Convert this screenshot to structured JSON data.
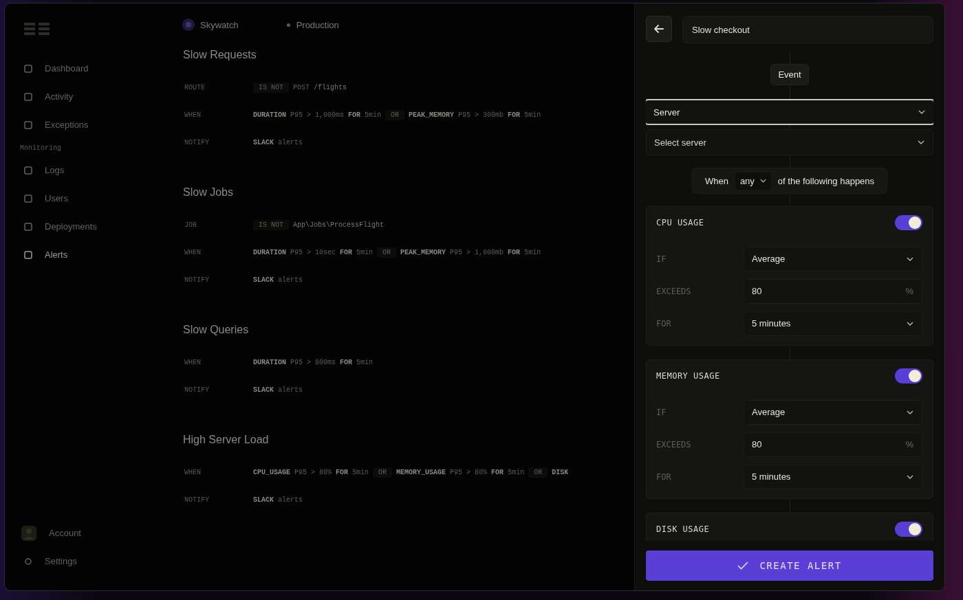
{
  "sidebar": {
    "groups": [
      {
        "items": [
          {
            "label": "Dashboard",
            "selected": false
          },
          {
            "label": "Activity",
            "selected": false
          },
          {
            "label": "Exceptions",
            "selected": false
          }
        ]
      },
      {
        "heading": "Monitoring",
        "items": [
          {
            "label": "Logs",
            "selected": false
          },
          {
            "label": "Users",
            "selected": false
          },
          {
            "label": "Deployments",
            "selected": false
          },
          {
            "label": "Alerts",
            "selected": true
          }
        ]
      }
    ],
    "footer": [
      {
        "label": "Account"
      },
      {
        "label": "Settings"
      }
    ]
  },
  "topbar": {
    "project": "Skywatch",
    "environment": "Production"
  },
  "rules": [
    {
      "title": "Slow Requests",
      "rows": [
        {
          "label": "ROUTE",
          "tokens": [
            {
              "kind": "op",
              "text": "IS NOT"
            },
            {
              "kind": "val",
              "text": "POST"
            },
            {
              "kind": "path",
              "text": "/flights"
            }
          ]
        },
        {
          "label": "WHEN",
          "tokens": [
            {
              "kind": "key",
              "text": "DURATION"
            },
            {
              "kind": "val",
              "text": "P95 > 1,000ms"
            },
            {
              "kind": "key",
              "text": "FOR"
            },
            {
              "kind": "val",
              "text": "5min"
            },
            {
              "kind": "op",
              "text": "OR"
            },
            {
              "kind": "key",
              "text": "PEAK_MEMORY"
            },
            {
              "kind": "val",
              "text": "P95 > 300mb"
            },
            {
              "kind": "key",
              "text": "FOR"
            },
            {
              "kind": "val",
              "text": "5min"
            }
          ]
        },
        {
          "label": "NOTIFY",
          "tokens": [
            {
              "kind": "key",
              "text": "SLACK"
            },
            {
              "kind": "val",
              "text": "alerts"
            }
          ]
        }
      ]
    },
    {
      "title": "Slow Jobs",
      "rows": [
        {
          "label": "JOB",
          "tokens": [
            {
              "kind": "op",
              "text": "IS NOT"
            },
            {
              "kind": "path",
              "text": "App\\Jobs\\ProcessFlight"
            }
          ]
        },
        {
          "label": "WHEN",
          "tokens": [
            {
              "kind": "key",
              "text": "DURATION"
            },
            {
              "kind": "val",
              "text": "P95 > 10sec"
            },
            {
              "kind": "key",
              "text": "FOR"
            },
            {
              "kind": "val",
              "text": "5min"
            },
            {
              "kind": "op",
              "text": "OR"
            },
            {
              "kind": "key",
              "text": "PEAK_MEMORY"
            },
            {
              "kind": "val",
              "text": "P95 > 1,000mb"
            },
            {
              "kind": "key",
              "text": "FOR"
            },
            {
              "kind": "val",
              "text": "5min"
            }
          ]
        },
        {
          "label": "NOTIFY",
          "tokens": [
            {
              "kind": "key",
              "text": "SLACK"
            },
            {
              "kind": "val",
              "text": "alerts"
            }
          ]
        }
      ]
    },
    {
      "title": "Slow Queries",
      "rows": [
        {
          "label": "WHEN",
          "tokens": [
            {
              "kind": "key",
              "text": "DURATION"
            },
            {
              "kind": "val",
              "text": "P95 > 800ms"
            },
            {
              "kind": "key",
              "text": "FOR"
            },
            {
              "kind": "val",
              "text": "5min"
            }
          ]
        },
        {
          "label": "NOTIFY",
          "tokens": [
            {
              "kind": "key",
              "text": "SLACK"
            },
            {
              "kind": "val",
              "text": "alerts"
            }
          ]
        }
      ]
    },
    {
      "title": "High Server Load",
      "rows": [
        {
          "label": "WHEN",
          "tokens": [
            {
              "kind": "key",
              "text": "CPU_USAGE"
            },
            {
              "kind": "val",
              "text": "P95 > 80%"
            },
            {
              "kind": "key",
              "text": "FOR"
            },
            {
              "kind": "val",
              "text": "5min"
            },
            {
              "kind": "op",
              "text": "OR"
            },
            {
              "kind": "key",
              "text": "MEMORY_USAGE"
            },
            {
              "kind": "val",
              "text": "P95 > 80%"
            },
            {
              "kind": "key",
              "text": "FOR"
            },
            {
              "kind": "val",
              "text": "5min"
            },
            {
              "kind": "op",
              "text": "OR"
            },
            {
              "kind": "key",
              "text": "DISK"
            }
          ]
        },
        {
          "label": "NOTIFY",
          "tokens": [
            {
              "kind": "key",
              "text": "SLACK"
            },
            {
              "kind": "val",
              "text": "alerts"
            }
          ]
        }
      ]
    }
  ],
  "panel": {
    "name": "Slow checkout",
    "source_label": "Event",
    "source": {
      "value": "Server",
      "focused": true
    },
    "target": {
      "placeholder": "Select server"
    },
    "match": {
      "prefix": "When",
      "mode": "any",
      "suffix": "of the following happens"
    },
    "cards": [
      {
        "title": "CPU USAGE",
        "on": true,
        "fields": [
          {
            "label": "IF",
            "kind": "select",
            "value": "Average"
          },
          {
            "label": "EXCEEDS",
            "kind": "input",
            "value": "80",
            "unit": "%"
          },
          {
            "label": "FOR",
            "kind": "select",
            "value": "5 minutes"
          }
        ]
      },
      {
        "title": "MEMORY USAGE",
        "on": true,
        "fields": [
          {
            "label": "IF",
            "kind": "select",
            "value": "Average"
          },
          {
            "label": "EXCEEDS",
            "kind": "input",
            "value": "80",
            "unit": "%"
          },
          {
            "label": "FOR",
            "kind": "select",
            "value": "5 minutes"
          }
        ]
      },
      {
        "title": "DISK USAGE",
        "on": true
      }
    ],
    "submit": "CREATE ALERT"
  }
}
